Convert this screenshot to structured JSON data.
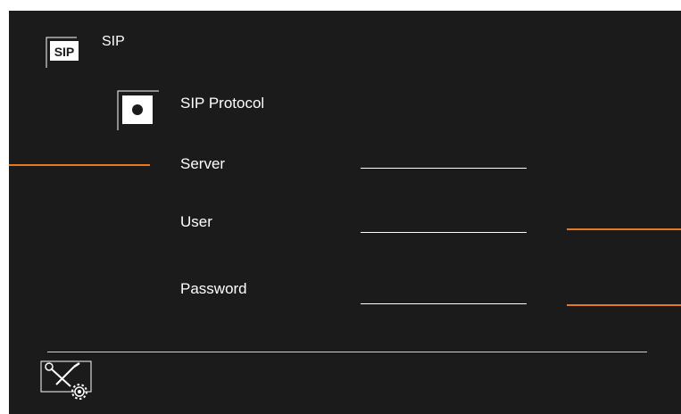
{
  "header": {
    "title": "SIP",
    "icon": "sip-icon",
    "icon_text": "SIP"
  },
  "protocol": {
    "label": "SIP Protocol",
    "selected": true,
    "icon": "radio-icon"
  },
  "fields": {
    "server": {
      "label": "Server",
      "value": ""
    },
    "user": {
      "label": "User",
      "value": ""
    },
    "password": {
      "label": "Password",
      "value": ""
    }
  },
  "footer": {
    "icon": "tools-settings-icon"
  },
  "colors": {
    "background": "#1b1b1b",
    "text": "#ffffff",
    "pointer": "#e87722"
  }
}
